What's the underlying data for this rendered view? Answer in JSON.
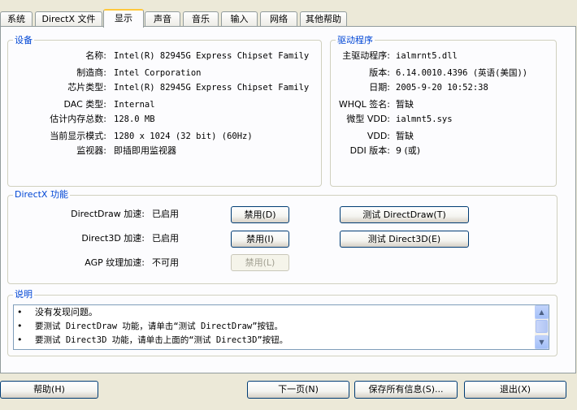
{
  "tabs": [
    {
      "label": "系统"
    },
    {
      "label": "DirectX 文件"
    },
    {
      "label": "显示"
    },
    {
      "label": "声音"
    },
    {
      "label": "音乐"
    },
    {
      "label": "输入"
    },
    {
      "label": "网络"
    },
    {
      "label": "其他帮助"
    }
  ],
  "device": {
    "title": "设备",
    "rows": [
      {
        "label": "名称:",
        "value": "Intel(R) 82945G Express Chipset Family"
      },
      {
        "label": "制造商:",
        "value": "Intel Corporation"
      },
      {
        "label": "芯片类型:",
        "value": "Intel(R) 82945G Express Chipset Family"
      },
      {
        "label": "DAC 类型:",
        "value": "Internal"
      },
      {
        "label": "估计内存总数:",
        "value": "128.0 MB"
      },
      {
        "label": "当前显示模式:",
        "value": "1280 x 1024 (32 bit) (60Hz)"
      },
      {
        "label": "监视器:",
        "value": "即插即用监视器"
      }
    ]
  },
  "driver": {
    "title": "驱动程序",
    "rows": [
      {
        "label": "主驱动程序:",
        "value": "ialmrnt5.dll"
      },
      {
        "label": "版本:",
        "value": "6.14.0010.4396 (英语(美国))"
      },
      {
        "label": "日期:",
        "value": "2005-9-20 10:52:38"
      },
      {
        "label": "WHQL 签名:",
        "value": "暂缺"
      },
      {
        "label": "微型 VDD:",
        "value": "ialmnt5.sys"
      },
      {
        "label": "VDD:",
        "value": "暂缺"
      },
      {
        "label": "DDI 版本:",
        "value": "9 (或)"
      }
    ]
  },
  "features": {
    "title": "DirectX 功能",
    "rows": [
      {
        "label": "DirectDraw 加速:",
        "status": "已启用",
        "disable_btn": "禁用(D)",
        "test_btn": "测试 DirectDraw(T)"
      },
      {
        "label": "Direct3D 加速:",
        "status": "已启用",
        "disable_btn": "禁用(I)",
        "test_btn": "测试 Direct3D(E)"
      },
      {
        "label": "AGP 纹理加速:",
        "status": "不可用",
        "disable_btn": "禁用(L)"
      }
    ]
  },
  "notes": {
    "title": "说明",
    "bullet": "•",
    "lines": [
      "没有发现问题。",
      "要测试 DirectDraw 功能，请单击“测试 DirectDraw”按钮。",
      "要测试 Direct3D 功能，请单击上面的“测试 Direct3D”按钮。"
    ]
  },
  "footer": {
    "help": "帮助(H)",
    "next": "下一页(N)",
    "save": "保存所有信息(S)...",
    "exit": "退出(X)"
  }
}
